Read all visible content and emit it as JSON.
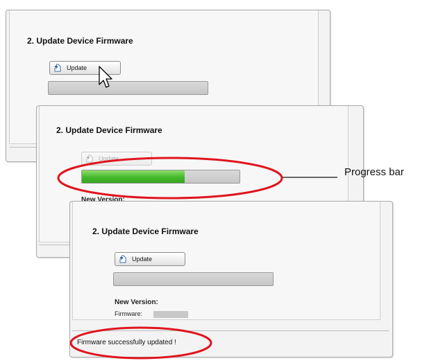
{
  "section_title": "2. Update Device Firmware",
  "update_button_label": "Update",
  "new_version_label": "New Version:",
  "firmware_label": "Firmware:",
  "status_message": "Firmware successfully updated !",
  "annotation_label": "Progress bar",
  "progress_window2": 0.65,
  "progress_window3": 0,
  "colors": {
    "progress_fill": "#44b82a",
    "highlight_ellipse": "#e0141e"
  }
}
